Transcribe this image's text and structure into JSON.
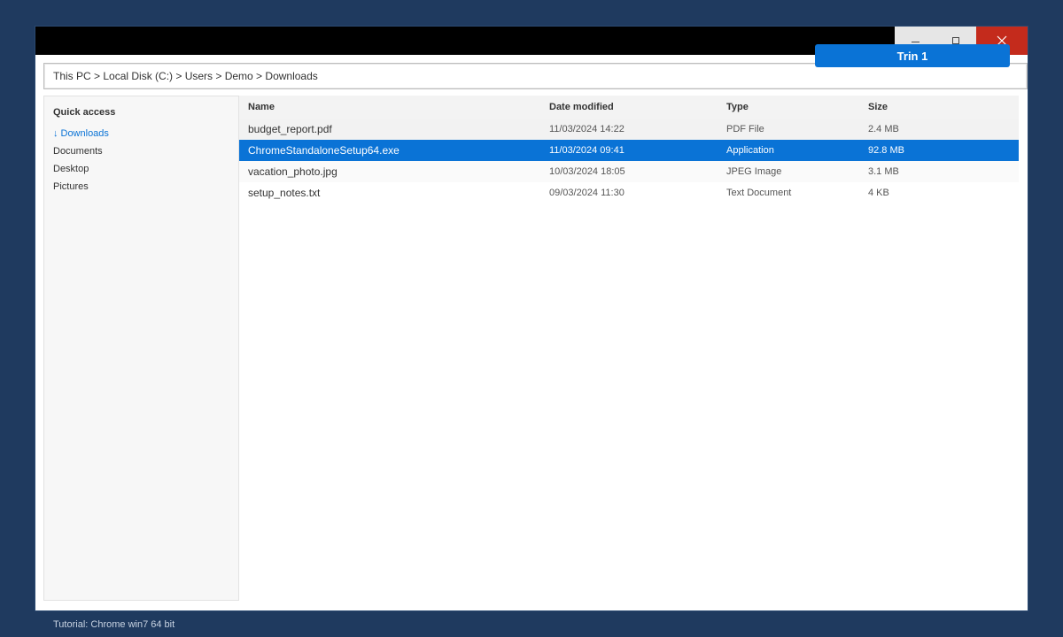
{
  "window": {
    "controls": {
      "close_icon": "close-icon",
      "minimize_icon": "minimize-icon",
      "maximize_icon": "maximize-icon"
    }
  },
  "badge": {
    "label": "Trin 1",
    "color": "#0a73d6"
  },
  "address": {
    "path": "This PC > Local Disk (C:) > Users > Demo > Downloads"
  },
  "sidebar": {
    "title": "Quick access",
    "items": [
      {
        "label": "Downloads",
        "icon": "down-arrow-icon",
        "arrow": "↓",
        "active": true
      },
      {
        "label": "Documents"
      },
      {
        "label": "Desktop"
      },
      {
        "label": "Pictures"
      }
    ]
  },
  "files": {
    "columns": {
      "name": "Name",
      "date": "Date modified",
      "type": "Type",
      "size": "Size"
    },
    "rows": [
      {
        "name": "budget_report.pdf",
        "date": "11/03/2024 14:22",
        "type": "PDF File",
        "size": "2.4 MB"
      },
      {
        "name": "ChromeStandaloneSetup64.exe",
        "date": "11/03/2024 09:41",
        "type": "Application",
        "size": "92.8 MB",
        "selected": true
      },
      {
        "name": "vacation_photo.jpg",
        "date": "10/03/2024 18:05",
        "type": "JPEG Image",
        "size": "3.1 MB"
      },
      {
        "name": "setup_notes.txt",
        "date": "09/03/2024 11:30",
        "type": "Text Document",
        "size": "4 KB"
      }
    ]
  },
  "colors": {
    "desktop": "#1f3a5f",
    "accent": "#0a73d6",
    "close": "#c42b1c"
  },
  "footer": {
    "text": "Tutorial: Chrome win7 64 bit"
  }
}
